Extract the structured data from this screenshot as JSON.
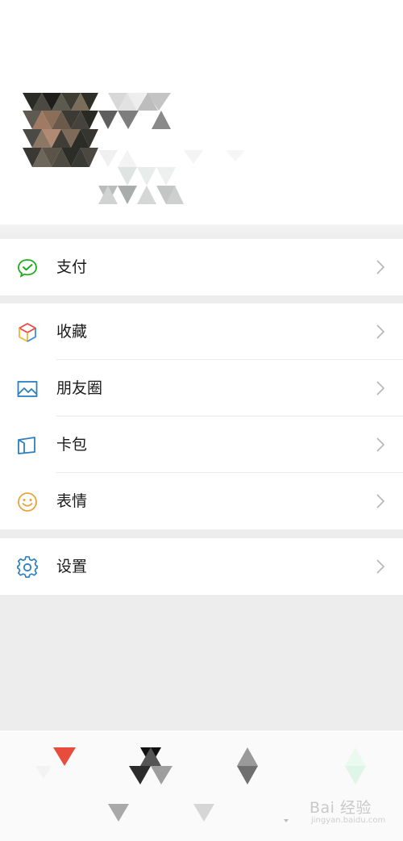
{
  "menu": {
    "pay": {
      "label": "支付",
      "icon": "wechat-pay-icon",
      "color": "#1aad19"
    },
    "favorites": {
      "label": "收藏",
      "icon": "cube-icon"
    },
    "moments": {
      "label": "朋友圈",
      "icon": "picture-icon",
      "color": "#2b7fc2"
    },
    "cards": {
      "label": "卡包",
      "icon": "card-wallet-icon",
      "color": "#2b7fc2"
    },
    "stickers": {
      "label": "表情",
      "icon": "smiley-icon",
      "color": "#e8a33a"
    },
    "settings": {
      "label": "设置",
      "icon": "gear-icon",
      "color": "#2b7fc2"
    }
  },
  "watermark": {
    "main": "Bai 经验",
    "sub": "jingyan.baidu.com"
  }
}
